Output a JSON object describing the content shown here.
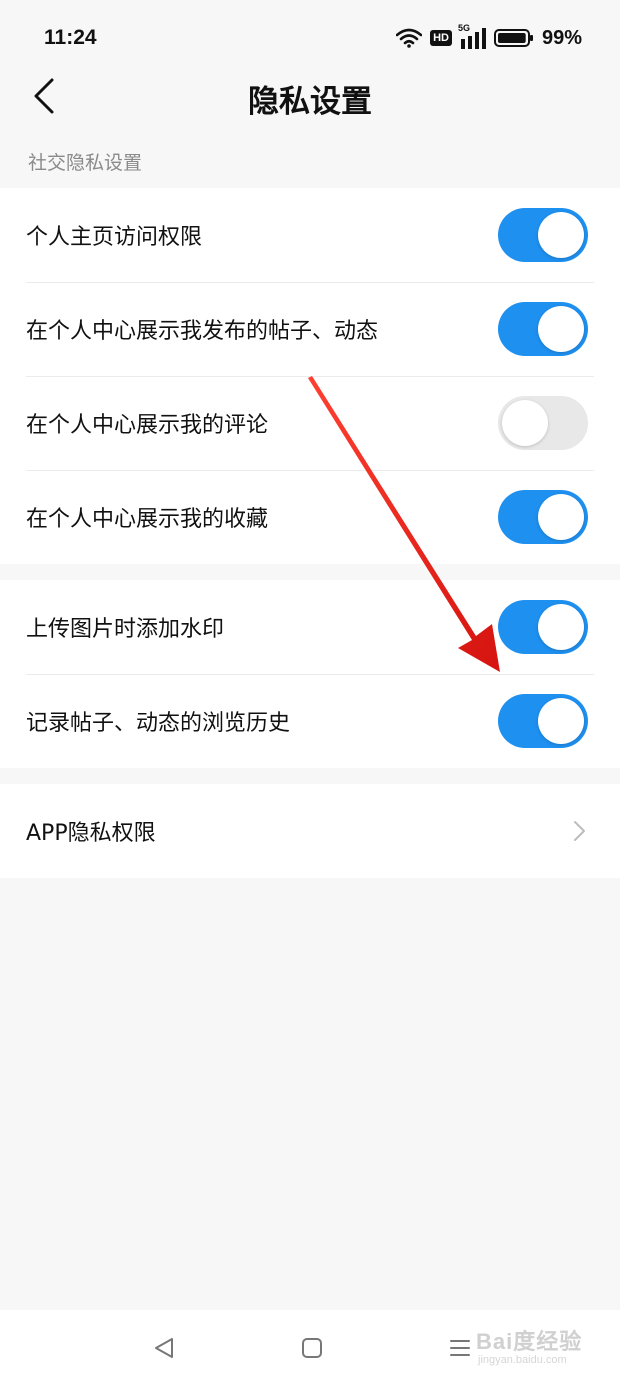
{
  "status_bar": {
    "time": "11:24",
    "hd_label": "HD",
    "network_label": "5G",
    "battery_percent": "99%",
    "battery_level": 0.99
  },
  "header": {
    "title": "隐私设置",
    "back_icon": "chevron-left-icon"
  },
  "social_section": {
    "label": "社交隐私设置",
    "items": [
      {
        "label": "个人主页访问权限",
        "enabled": true
      },
      {
        "label": "在个人中心展示我发布的帖子、动态",
        "enabled": true
      },
      {
        "label": "在个人中心展示我的评论",
        "enabled": false
      },
      {
        "label": "在个人中心展示我的收藏",
        "enabled": true
      }
    ]
  },
  "other_section": {
    "items": [
      {
        "label": "上传图片时添加水印",
        "enabled": true
      },
      {
        "label": "记录帖子、动态的浏览历史",
        "enabled": true
      }
    ]
  },
  "app_section": {
    "label": "APP隐私权限",
    "icon": "chevron-right-icon"
  },
  "bottom_nav": {
    "icons": [
      "back-triangle-icon",
      "home-square-icon",
      "menu-lines-icon"
    ]
  },
  "watermark": {
    "text": "Bai度经验",
    "sub": "jingyan.baidu.com"
  },
  "colors": {
    "accent": "#1e90f0",
    "toggle_off": "#e8e8e8",
    "background": "#f7f7f7",
    "annotation_arrow": "#e8140f"
  }
}
